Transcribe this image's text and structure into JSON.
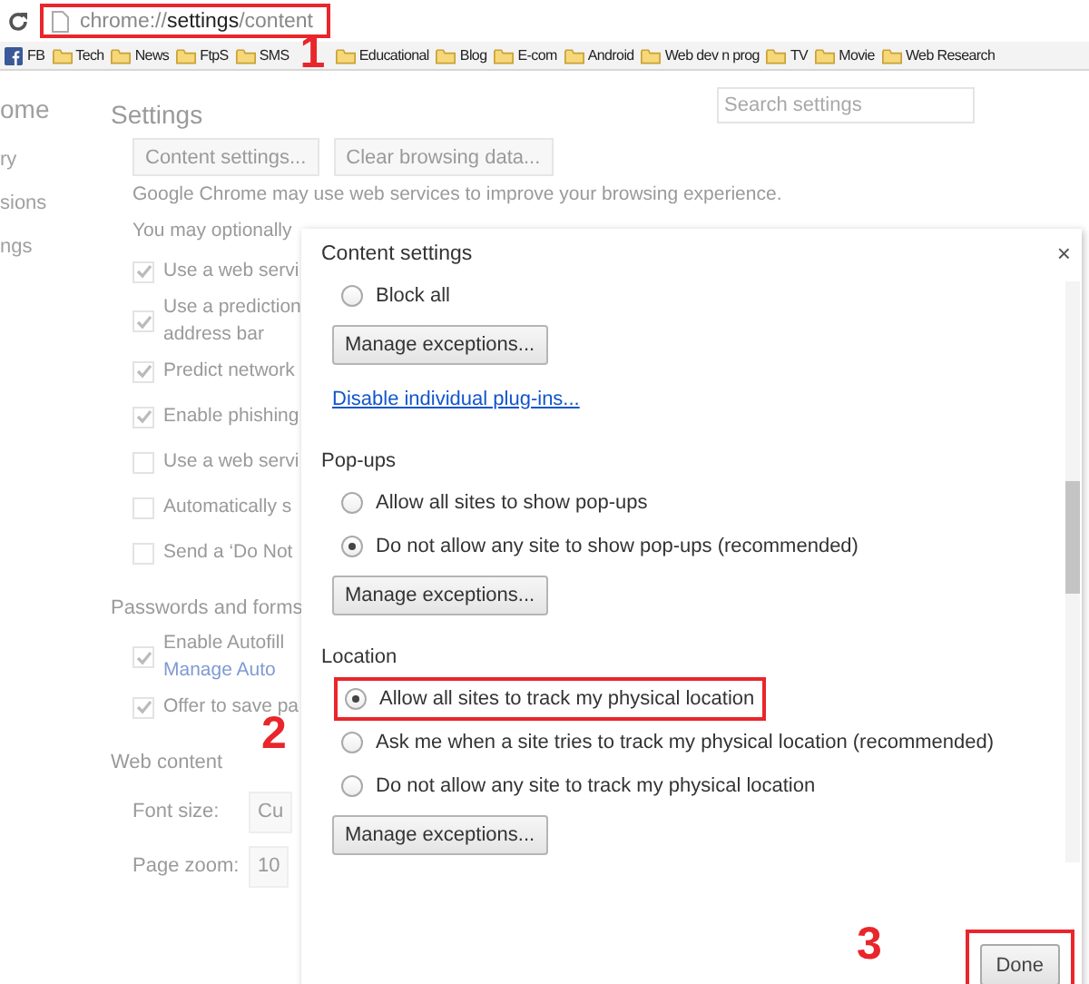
{
  "toolbar": {
    "address": {
      "scheme": "chrome://",
      "host": "settings",
      "path": "/content",
      "highlighted": true
    }
  },
  "bookmarks": [
    {
      "kind": "site",
      "label": "FB"
    },
    {
      "kind": "folder",
      "label": "Tech"
    },
    {
      "kind": "folder",
      "label": "News"
    },
    {
      "kind": "folder",
      "label": "FtpS"
    },
    {
      "kind": "folder",
      "label": "SMS"
    },
    {
      "kind": "folder",
      "label": "Educational"
    },
    {
      "kind": "folder",
      "label": "Blog"
    },
    {
      "kind": "folder",
      "label": "E-com"
    },
    {
      "kind": "folder",
      "label": "Android"
    },
    {
      "kind": "folder",
      "label": "Web dev n prog"
    },
    {
      "kind": "folder",
      "label": "TV"
    },
    {
      "kind": "folder",
      "label": "Movie"
    },
    {
      "kind": "folder",
      "label": "Web Research"
    }
  ],
  "sidebar": {
    "title": "ome",
    "items": [
      "ry",
      "sions",
      "ngs"
    ]
  },
  "settings": {
    "title": "Settings",
    "search": {
      "placeholder": "Search settings"
    },
    "buttons": [
      "Content settings...",
      "Clear browsing data..."
    ],
    "rows": [
      {
        "kind": "text",
        "text": "Google Chrome may use web services to improve your browsing experience."
      },
      {
        "kind": "text",
        "text": "You may optionally"
      },
      {
        "kind": "checkbox",
        "text": "Use a web servi",
        "checked": true
      },
      {
        "kind": "checkbox",
        "text": "Use a prediction",
        "text2": "address bar",
        "checked": true
      },
      {
        "kind": "checkbox",
        "text": "Predict network",
        "checked": true
      },
      {
        "kind": "checkbox",
        "text": "Enable phishing",
        "checked": true
      },
      {
        "kind": "checkbox",
        "text": "Use a web servi",
        "checked": false
      },
      {
        "kind": "checkbox",
        "text": "Automatically s",
        "checked": false
      },
      {
        "kind": "checkbox",
        "text": "Send a ‘Do Not",
        "checked": false
      },
      {
        "kind": "heading",
        "text": "Passwords and forms"
      },
      {
        "kind": "checkbox",
        "text": "Enable Autofill",
        "link": "Manage Auto",
        "checked": true
      },
      {
        "kind": "checkbox",
        "text": "Offer to save pa",
        "checked": true
      },
      {
        "kind": "heading",
        "text": "Web content"
      },
      {
        "kind": "select",
        "text": "Font size:",
        "value": "Cu"
      },
      {
        "kind": "select",
        "text": "Page zoom:",
        "value": "10"
      }
    ]
  },
  "dialog": {
    "title": "Content settings",
    "close": "×",
    "items": [
      {
        "kind": "radio",
        "text": "Block all",
        "selected": false
      },
      {
        "kind": "button",
        "text": "Manage exceptions..."
      },
      {
        "kind": "link",
        "text": "Disable individual plug-ins..."
      },
      {
        "kind": "heading",
        "text": "Pop-ups"
      },
      {
        "kind": "radio",
        "text": "Allow all sites to show pop-ups",
        "selected": false
      },
      {
        "kind": "radio",
        "text": "Do not allow any site to show pop-ups (recommended)",
        "selected": true
      },
      {
        "kind": "button",
        "text": "Manage exceptions..."
      },
      {
        "kind": "heading",
        "text": "Location"
      },
      {
        "kind": "radio",
        "text": "Allow all sites to track my physical location",
        "selected": true,
        "highlighted": true
      },
      {
        "kind": "radio",
        "text": "Ask me when a site tries to track my physical location (recommended)",
        "selected": false
      },
      {
        "kind": "radio",
        "text": "Do not allow any site to track my physical location",
        "selected": false
      },
      {
        "kind": "button",
        "text": "Manage exceptions..."
      }
    ],
    "done": {
      "label": "Done",
      "highlighted": true
    }
  },
  "markers": [
    "1",
    "2",
    "3"
  ]
}
